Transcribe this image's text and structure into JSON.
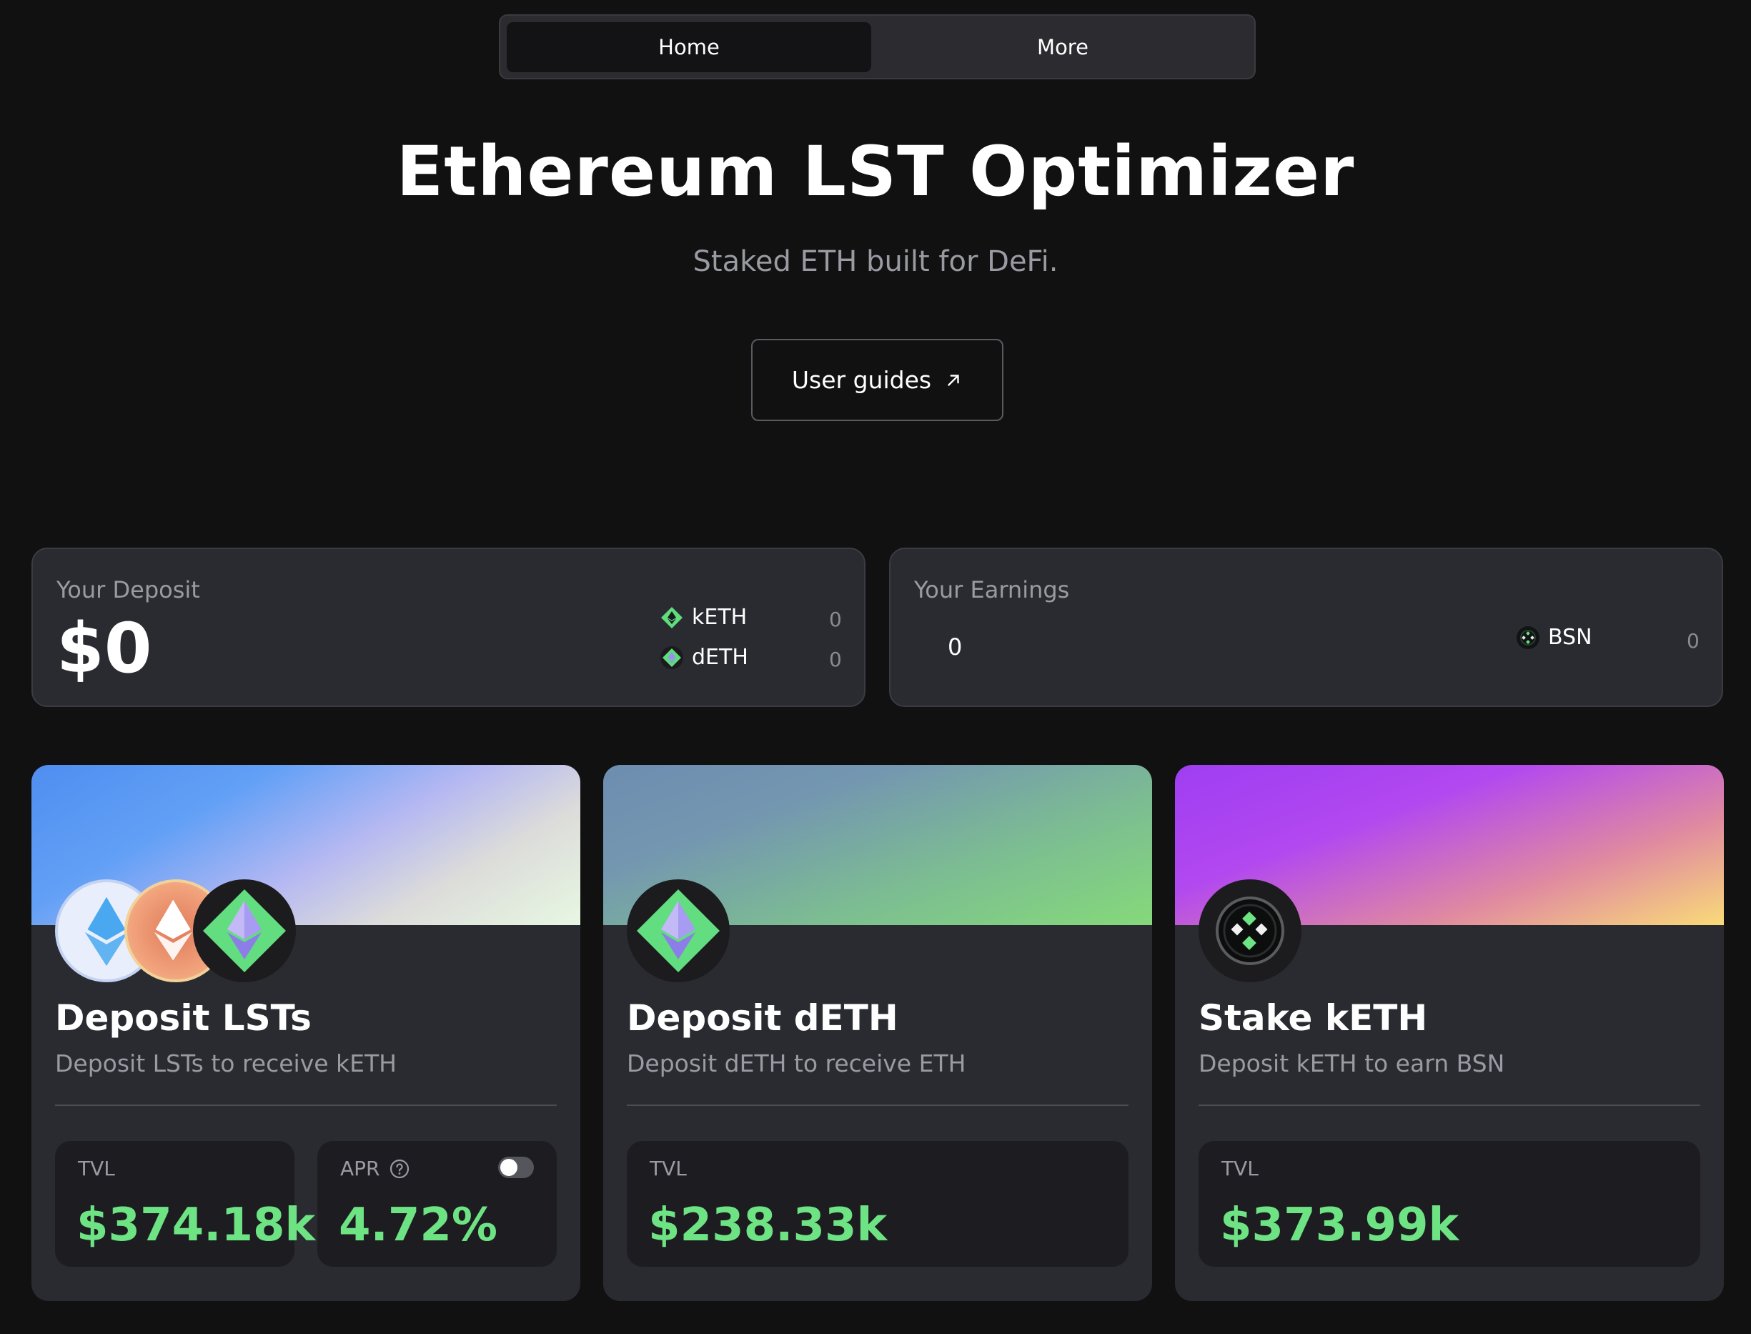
{
  "nav": {
    "tabs": [
      {
        "label": "Home",
        "active": true
      },
      {
        "label": "More",
        "active": false
      }
    ]
  },
  "hero": {
    "title": "Ethereum LST Optimizer",
    "subtitle": "Staked ETH built for DeFi.",
    "guides_label": "User guides"
  },
  "deposit": {
    "label": "Your Deposit",
    "value": "$0",
    "tokens": [
      {
        "name": "kETH",
        "amount": "0",
        "icon": "keth-icon"
      },
      {
        "name": "dETH",
        "amount": "0",
        "icon": "deth-icon"
      }
    ]
  },
  "earnings": {
    "label": "Your Earnings",
    "value": "0",
    "tokens": [
      {
        "name": "BSN",
        "amount": "0",
        "icon": "bsn-icon"
      }
    ]
  },
  "cards": [
    {
      "title": "Deposit LSTs",
      "desc": "Deposit LSTs to receive kETH",
      "tvl_label": "TVL",
      "tvl": "$374.18k",
      "apr_label": "APR",
      "apr": "4.72%",
      "icons": [
        "lido-steth-icon",
        "rocketpool-reth-icon",
        "keth-icon"
      ]
    },
    {
      "title": "Deposit dETH",
      "desc": "Deposit dETH to receive ETH",
      "tvl_label": "TVL",
      "tvl": "$238.33k",
      "icons": [
        "deth-icon"
      ]
    },
    {
      "title": "Stake kETH",
      "desc": "Deposit kETH to earn BSN",
      "tvl_label": "TVL",
      "tvl": "$373.99k",
      "icons": [
        "bsn-coin-icon"
      ]
    }
  ],
  "colors": {
    "accent_green": "#6ee384",
    "background": "#111112",
    "panel": "#2a2b31"
  }
}
